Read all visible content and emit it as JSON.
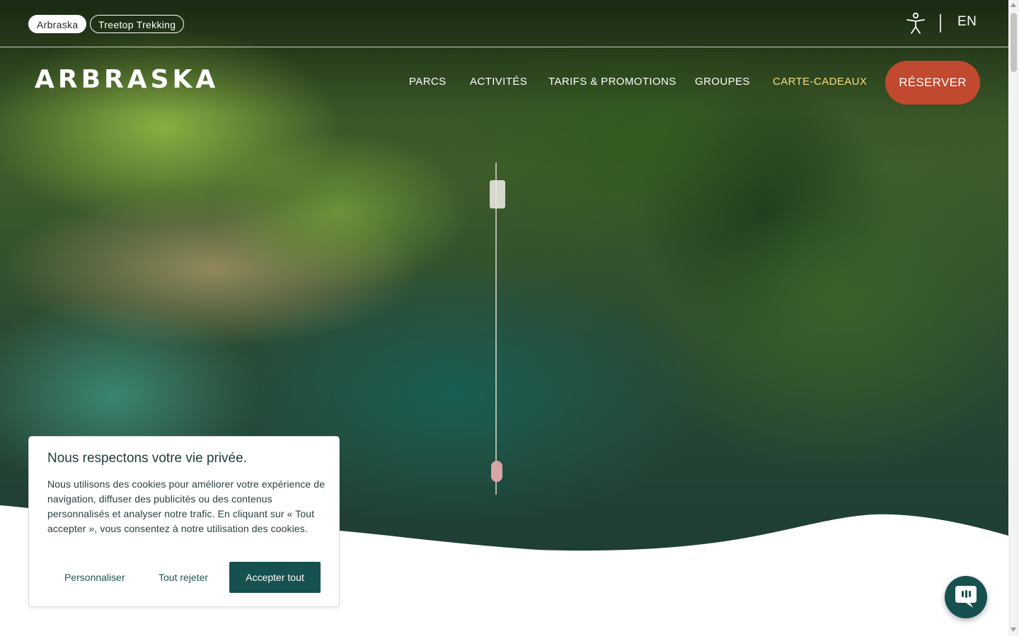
{
  "topbar": {
    "brand_pills": [
      {
        "label": "Arbraska",
        "active": true
      },
      {
        "label": "Treetop Trekking",
        "active": false
      }
    ],
    "accessibility_icon": "accessibility-icon",
    "language": "EN"
  },
  "header": {
    "logo_text": "ARBRASKA",
    "nav": [
      {
        "label": "PARCS"
      },
      {
        "label": "ACTIVITÉS"
      },
      {
        "label": "TARIFS & PROMOTIONS"
      },
      {
        "label": "GROUPES"
      },
      {
        "label": "CARTE-CADEAUX",
        "highlight_color": "#f2e07a"
      }
    ],
    "cta_label": "RÉSERVER",
    "cta_color": "#c0492f"
  },
  "cookie_banner": {
    "title": "Nous respectons votre vie privée.",
    "text": "Nous utilisons des cookies pour améliorer votre expérience de navigation, diffuser des publicités ou des contenus personnalisés et analyser notre trafic. En cliquant sur « Tout accepter », vous consentez à notre utilisation des cookies.",
    "customize_label": "Personnaliser",
    "reject_label": "Tout rejeter",
    "accept_label": "Accepter tout",
    "accent_color": "#17514f"
  },
  "chat": {
    "icon": "chat-bubble-icon"
  }
}
